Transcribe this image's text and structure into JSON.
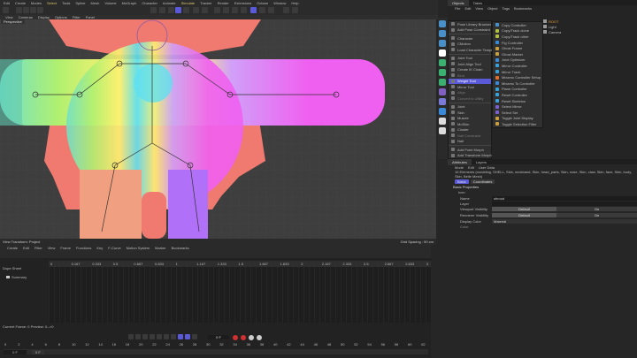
{
  "menubar": [
    "Edit",
    "Create",
    "Modes",
    "Select",
    "Tools",
    "Spline",
    "Mesh",
    "Volume",
    "MoGraph",
    "Character",
    "Animate",
    "Simulate",
    "Tracker",
    "Render",
    "Extensions",
    "Octane",
    "Window",
    "Help"
  ],
  "viewport": {
    "menu": [
      "View",
      "Cameras",
      "Display",
      "Options",
      "Filter",
      "Panel"
    ],
    "label": "Perspective",
    "status_left": "View Transform: Project",
    "grid_spacing": "Grid Spacing : 50 cm",
    "colors": {
      "body": "#f07a70",
      "magenta": "#f060f0",
      "yellow": "#fff070",
      "cyan": "#70e0f0"
    }
  },
  "objects": {
    "tabs": [
      "Objects",
      "Takes"
    ],
    "menu": [
      "File",
      "Edit",
      "View",
      "Object",
      "Tags",
      "Bookmarks"
    ],
    "items": [
      {
        "name": "ROOT",
        "color": "#e8a040"
      },
      {
        "name": "Light"
      },
      {
        "name": "Camera"
      }
    ]
  },
  "character_menu": {
    "items": [
      {
        "label": "Pose Library Browser"
      },
      {
        "label": "Add Pose Constraint"
      },
      {
        "sep": true
      },
      {
        "label": "Character"
      },
      {
        "label": "CMotion"
      },
      {
        "label": "Load Character Template"
      },
      {
        "sep": true
      },
      {
        "label": "Joint Tool"
      },
      {
        "label": "Joint Align Tool"
      },
      {
        "label": "Create IK Chain"
      },
      {
        "label": "Bind",
        "disabled": true
      },
      {
        "label": "Weight Tool",
        "selected": true
      },
      {
        "label": "Mirror Tool"
      },
      {
        "label": "Align",
        "disabled": true
      },
      {
        "label": "Convert to Utility",
        "disabled": true
      },
      {
        "sep": true
      },
      {
        "label": "Joint"
      },
      {
        "label": "Skin"
      },
      {
        "label": "Muscle"
      },
      {
        "label": "MoSkin"
      },
      {
        "label": "Cluster"
      },
      {
        "label": "Nail Constraint",
        "disabled": true
      },
      {
        "label": "Nail"
      },
      {
        "sep": true
      },
      {
        "label": "Add Point Morph"
      },
      {
        "label": "Add Transform Morph"
      }
    ]
  },
  "submenu": {
    "items": [
      "Copy Controller",
      "Copy/Track clone",
      "Copy/Track other",
      "Fig Controller",
      "Ghost Frame",
      "Ghost Marker",
      "Joint Optimizer",
      "Mirror Controller",
      "Mirror Track",
      "Mixamo Controller Setup",
      "Mixamo To Controller",
      "Plane Controller",
      "Reset Controller",
      "Reset Skeleton",
      "Select Mirror",
      "Select Set",
      "Toggle Joint Display",
      "Toggle Selection Filter"
    ]
  },
  "attributes": {
    "tabs": [
      "Attributes",
      "Layers"
    ],
    "menu": [
      "Mode",
      "Edit",
      "User Data"
    ],
    "elements": "16 Elements (modeling, SHELL, Skin, neckband, Skin, head_parts, Skin, nose, Skin, claw, Skin, face, Skin, body, Skin, Belle Mesh)",
    "subtabs": [
      "Basic",
      "Coordinates"
    ],
    "section": "Basic Properties",
    "group": "Icon",
    "name_label": "Name",
    "name_value": "shroud",
    "layer_label": "Layer",
    "viewport_label": "Viewport Visibility",
    "viewport_value": "Default",
    "viewport_on": "On",
    "renderer_label": "Renderer Visibility",
    "renderer_value": "Default",
    "renderer_on": "On",
    "display_color_label": "Display Color",
    "display_color_value": "Material",
    "color_label": "Color"
  },
  "timeline": {
    "menu": [
      "Create",
      "Edit",
      "Filter",
      "View",
      "Frame",
      "Functions",
      "Key",
      "F-Curve",
      "Motion System",
      "Marker",
      "Bookmarks"
    ],
    "tree_header": "Dope Sheet",
    "summary": "Summary",
    "ticks": [
      "0",
      "0.167",
      "0.333",
      "0.5",
      "0.667",
      "0.833",
      "1",
      "1.167",
      "1.333",
      "1.5",
      "1.667",
      "1.833",
      "2",
      "2.167",
      "2.333",
      "2.5",
      "2.667",
      "2.833",
      "3"
    ]
  },
  "transport": {
    "status": "Current Frame: 0 Preview: 0-->0",
    "frame": "0 F",
    "ruler": [
      "0",
      "2",
      "4",
      "6",
      "8",
      "10",
      "12",
      "14",
      "16",
      "18",
      "20",
      "22",
      "24",
      "26",
      "28",
      "30",
      "32",
      "34",
      "36",
      "38",
      "40",
      "42",
      "44",
      "46",
      "48",
      "50",
      "52",
      "54",
      "56",
      "58",
      "60",
      "62"
    ],
    "start": "0 F",
    "end": "0 F"
  }
}
